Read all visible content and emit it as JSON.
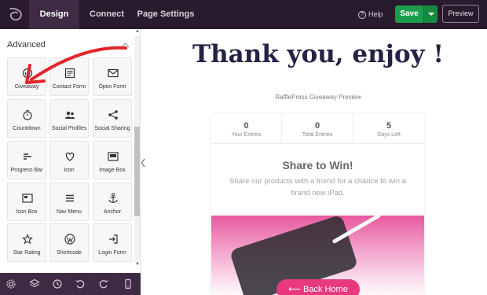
{
  "topbar": {
    "tabs": [
      {
        "label": "Design",
        "active": true
      },
      {
        "label": "Connect",
        "active": false
      },
      {
        "label": "Page Settings",
        "active": false
      }
    ],
    "help_label": "Help",
    "save_label": "Save",
    "preview_label": "Preview"
  },
  "sidebar": {
    "section_title": "Advanced",
    "blocks": [
      {
        "label": "Giveaway",
        "icon": "giveaway-icon"
      },
      {
        "label": "Contact Form",
        "icon": "contact-form-icon"
      },
      {
        "label": "Optin Form",
        "icon": "envelope-icon"
      },
      {
        "label": "Countdown",
        "icon": "stopwatch-icon"
      },
      {
        "label": "Social Profiles",
        "icon": "people-icon"
      },
      {
        "label": "Social Sharing",
        "icon": "share-icon"
      },
      {
        "label": "Progress Bar",
        "icon": "progress-bar-icon"
      },
      {
        "label": "Icon",
        "icon": "heart-icon"
      },
      {
        "label": "Image Box",
        "icon": "image-box-icon"
      },
      {
        "label": "Icon Box",
        "icon": "icon-box-icon"
      },
      {
        "label": "Nav Menu",
        "icon": "menu-icon"
      },
      {
        "label": "Anchor",
        "icon": "anchor-icon"
      },
      {
        "label": "Star Rating",
        "icon": "star-icon"
      },
      {
        "label": "Shortcode",
        "icon": "wordpress-icon"
      },
      {
        "label": "Login Form",
        "icon": "login-icon"
      }
    ]
  },
  "preview": {
    "headline": "Thank you, enjoy !",
    "subtitle": "RafflePress Giveaway Preview",
    "stats": [
      {
        "value": "0",
        "label": "Your Entries"
      },
      {
        "value": "0",
        "label": "Total Entries"
      },
      {
        "value": "5",
        "label": "Days Left"
      }
    ],
    "share_title": "Share to Win!",
    "share_text": "Share our products with a friend for a chance to win a brand new iPad.",
    "back_button": "⟵ Back Home"
  },
  "colors": {
    "topbar_bg": "#2a1a2e",
    "save_green": "#1b9e4b",
    "accent_pink": "#e8397f",
    "headline_navy": "#232346",
    "annotation_red": "#e0262b"
  }
}
